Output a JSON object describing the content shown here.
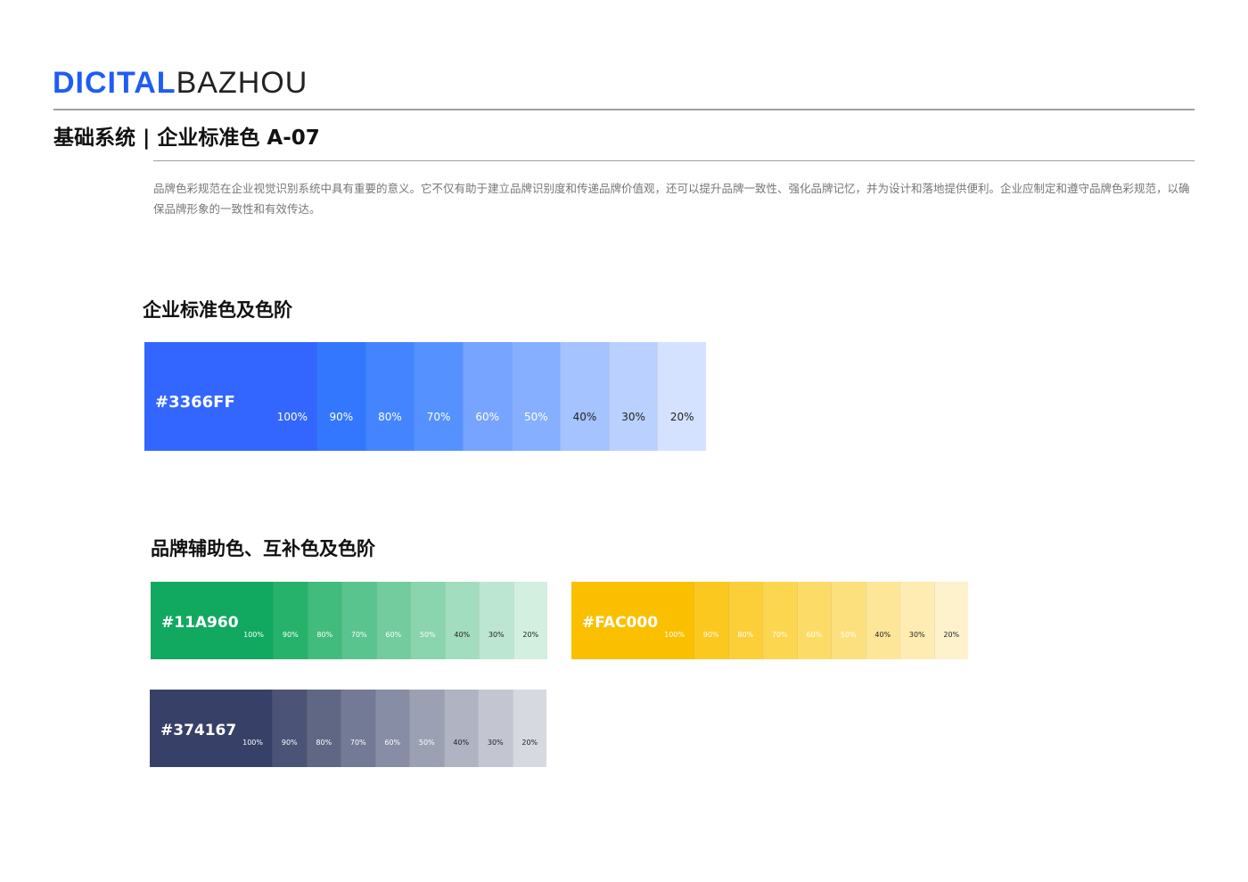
{
  "logo": {
    "part1": "DICITAL",
    "part2": "BAZHOU"
  },
  "header": {
    "title": "基础系统 | 企业标准色 A-07"
  },
  "intro": {
    "text": "品牌色彩规范在企业视觉识别系统中具有重要的意义。它不仅有助于建立品牌识别度和传递品牌价值观，还可以提升品牌一致性、强化品牌记忆，并为设计和落地提供便利。企业应制定和遵守品牌色彩规范，以确保品牌形象的一致性和有效传达。"
  },
  "standard": {
    "heading": "企业标准色及色阶",
    "hex": "#3366FF",
    "steps": [
      {
        "label": "100%",
        "color": "#3366FF",
        "text": "#ffffff"
      },
      {
        "label": "90%",
        "color": "#3377FF",
        "text": "#ffffff"
      },
      {
        "label": "80%",
        "color": "#4485FF",
        "text": "#ffffff"
      },
      {
        "label": "70%",
        "color": "#5592FF",
        "text": "#ffffff"
      },
      {
        "label": "60%",
        "color": "#76A4FF",
        "text": "#ffffff"
      },
      {
        "label": "50%",
        "color": "#86AFFF",
        "text": "#ffffff"
      },
      {
        "label": "40%",
        "color": "#A4C3FF",
        "text": "#222222"
      },
      {
        "label": "30%",
        "color": "#BAD1FF",
        "text": "#222222"
      },
      {
        "label": "20%",
        "color": "#D5E2FF",
        "text": "#222222"
      }
    ]
  },
  "auxiliary": {
    "heading": "品牌辅助色、互补色及色阶",
    "palettes": [
      {
        "hex": "#11A960",
        "steps": [
          {
            "label": "100%",
            "color": "#11A960",
            "text": "#ffffff"
          },
          {
            "label": "90%",
            "color": "#27B26C",
            "text": "#ffffff"
          },
          {
            "label": "80%",
            "color": "#41BC7D",
            "text": "#ffffff"
          },
          {
            "label": "70%",
            "color": "#5AC48F",
            "text": "#ffffff"
          },
          {
            "label": "60%",
            "color": "#72CC9D",
            "text": "#ffffff"
          },
          {
            "label": "50%",
            "color": "#8AD4AE",
            "text": "#ffffff"
          },
          {
            "label": "40%",
            "color": "#A3DDC0",
            "text": "#222222"
          },
          {
            "label": "30%",
            "color": "#BCE6D1",
            "text": "#222222"
          },
          {
            "label": "20%",
            "color": "#D2EFE0",
            "text": "#222222"
          }
        ]
      },
      {
        "hex": "#FAC000",
        "steps": [
          {
            "label": "100%",
            "color": "#FAC000",
            "text": "#ffffff"
          },
          {
            "label": "90%",
            "color": "#FBC820",
            "text": "#ffffff"
          },
          {
            "label": "80%",
            "color": "#FCCF39",
            "text": "#ffffff"
          },
          {
            "label": "70%",
            "color": "#FDD64F",
            "text": "#ffffff"
          },
          {
            "label": "60%",
            "color": "#FDDB67",
            "text": "#ffffff"
          },
          {
            "label": "50%",
            "color": "#FDE07E",
            "text": "#ffffff"
          },
          {
            "label": "40%",
            "color": "#FEE698",
            "text": "#222222"
          },
          {
            "label": "30%",
            "color": "#FEECB2",
            "text": "#222222"
          },
          {
            "label": "20%",
            "color": "#FEF2CC",
            "text": "#222222"
          }
        ]
      },
      {
        "hex": "#374167",
        "steps": [
          {
            "label": "100%",
            "color": "#374167",
            "text": "#ffffff"
          },
          {
            "label": "90%",
            "color": "#4B5476",
            "text": "#ffffff"
          },
          {
            "label": "80%",
            "color": "#5F6784",
            "text": "#ffffff"
          },
          {
            "label": "70%",
            "color": "#737A95",
            "text": "#ffffff"
          },
          {
            "label": "60%",
            "color": "#878DA4",
            "text": "#ffffff"
          },
          {
            "label": "50%",
            "color": "#9BA0B3",
            "text": "#ffffff"
          },
          {
            "label": "40%",
            "color": "#AFB3C2",
            "text": "#222222"
          },
          {
            "label": "30%",
            "color": "#C3C6D1",
            "text": "#222222"
          },
          {
            "label": "20%",
            "color": "#D7D9E1",
            "text": "#222222"
          }
        ]
      }
    ]
  }
}
